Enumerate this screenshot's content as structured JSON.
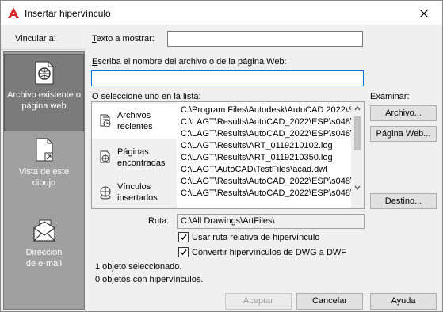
{
  "window": {
    "title": "Insertar hipervínculo"
  },
  "link_to": {
    "label": "Vincular a:",
    "items": [
      {
        "label_line1": "Archivo existente o",
        "label_line2": "página web",
        "icon": "web-page-icon",
        "active": true
      },
      {
        "label_line1": "Vista de este",
        "label_line2": "dibujo",
        "icon": "drawing-view-icon",
        "active": false
      },
      {
        "label_line1": "Dirección",
        "label_line2": "de e-mail",
        "icon": "email-icon",
        "active": false
      }
    ]
  },
  "text_to_display": {
    "label": "Texto a mostrar:",
    "value": ""
  },
  "filename": {
    "label": "Escriba el nombre del archivo o de la página Web:",
    "value": ""
  },
  "select_list": {
    "label": "O seleccione uno en la lista:",
    "tabs": [
      {
        "line1": "Archivos",
        "line2": "recientes",
        "icon": "recent-files-icon",
        "active": true
      },
      {
        "line1": "Páginas",
        "line2": "encontradas",
        "icon": "browsed-pages-icon",
        "active": false
      },
      {
        "line1": "Vínculos",
        "line2": "insertados",
        "icon": "inserted-links-icon",
        "active": false
      }
    ],
    "files": [
      "C:\\Program Files\\Autodesk\\AutoCAD 2022\\S",
      "C:\\LAGT\\Results\\AutoCAD_2022\\ESP\\s048\\",
      "C:\\LAGT\\Results\\AutoCAD_2022\\ESP\\s048\\",
      "C:\\LAGT\\Results\\ART_0119210102.log",
      "C:\\LAGT\\Results\\ART_0119210350.log",
      "C:\\LAGT\\AutoCAD\\TestFiles\\acad.dwt",
      "C:\\LAGT\\Results\\AutoCAD_2022\\ESP\\s048\\",
      "C:\\LAGT\\Results\\AutoCAD_2022\\ESP\\s048\\"
    ]
  },
  "browse": {
    "label": "Examinar:",
    "file_button": "Archivo...",
    "webpage_button": "Página Web...",
    "target_button": "Destino..."
  },
  "path": {
    "label": "Ruta:",
    "value": "C:\\All Drawings\\ArtFiles\\"
  },
  "options": {
    "relative_path": {
      "label": "Usar ruta relativa de hipervínculo",
      "checked": true
    },
    "convert_dwf": {
      "label": "Convertir hipervínculos de DWG a DWF",
      "checked": true
    }
  },
  "status": {
    "selected": "1 objeto seleccionado.",
    "with_links": "0 objetos con hipervínculos."
  },
  "buttons": {
    "accept": "Aceptar",
    "cancel": "Cancelar",
    "help": "Ayuda"
  },
  "colors": {
    "accent": "#0078d7",
    "autocad_red": "#d7262c",
    "panel_gray": "#a0a0a0",
    "panel_active": "#7b7b7b"
  }
}
